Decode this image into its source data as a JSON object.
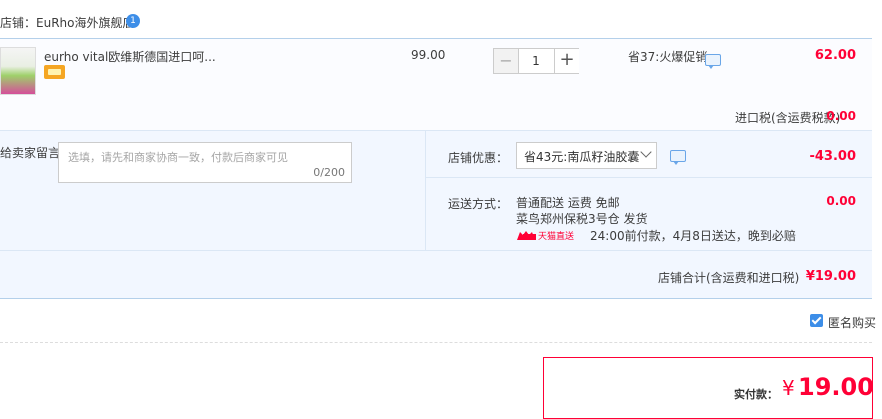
{
  "shop": {
    "name": "店铺：EuRho海外旗舰店",
    "badge": "1"
  },
  "item": {
    "title": "eurho vital欧维斯德国进口呵...",
    "unit_price": "99.00",
    "quantity": "1",
    "qty_minus": "−",
    "qty_plus": "+",
    "promo": "省37:火爆促销",
    "total": "62.00",
    "tax_label": "进口税(含运费税款)",
    "tax_value": "0.00"
  },
  "message": {
    "label": "给卖家留言：",
    "placeholder": "选填，请先和商家协商一致，付款后商家可见",
    "count": "0/200"
  },
  "coupon": {
    "label": "店铺优惠：",
    "selected": "省43元:南瓜籽油胶囊",
    "value": "-43.00"
  },
  "shipping": {
    "label": "运送方式：",
    "line1": "普通配送 运费 免邮",
    "line2": "菜鸟郑州保税3号仓   发货",
    "logo_text": "天猫直送",
    "line3": "24:00前付款，4月8日送达，晚到必赔",
    "value": "0.00"
  },
  "shop_total": {
    "label": "店铺合计(含运费和进口税)",
    "value": "¥19.00"
  },
  "anonymous": {
    "label": "匿名购买",
    "checked": true
  },
  "payment": {
    "label": "实付款：",
    "currency": "¥",
    "amount": "19.00"
  },
  "colors": {
    "accent": "#ff0036",
    "brand_blue": "#3d8ee8",
    "panel_bg": "#f2f7ff"
  }
}
